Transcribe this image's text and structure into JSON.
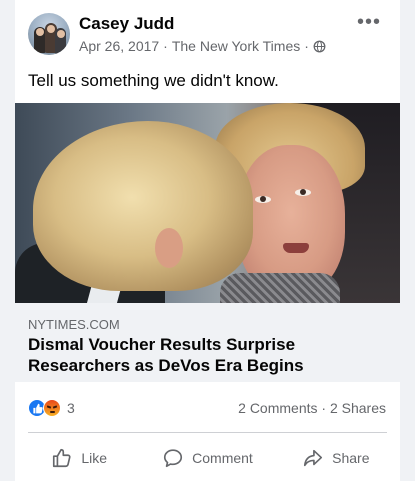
{
  "post": {
    "author": "Casey Judd",
    "date": "Apr 26, 2017",
    "separator1": "·",
    "source": "The New York Times",
    "separator2": "·",
    "text": "Tell us something we didn't know."
  },
  "link": {
    "domain": "NYTIMES.COM",
    "title": "Dismal Voucher Results Surprise Researchers as DeVos Era Begins"
  },
  "engagement": {
    "reactions_count": "3",
    "comments": "2 Comments",
    "dot": "·",
    "shares": "2 Shares"
  },
  "actions": {
    "like": "Like",
    "comment": "Comment",
    "share": "Share"
  },
  "icons": {
    "more": "more-options-icon",
    "privacy": "globe-icon",
    "reaction1": "like-reaction-icon",
    "reaction2": "angry-reaction-icon"
  },
  "colors": {
    "brand_blue": "#1877f2",
    "secondary_text": "#65676b",
    "link_box_bg": "#f0f2f5"
  }
}
